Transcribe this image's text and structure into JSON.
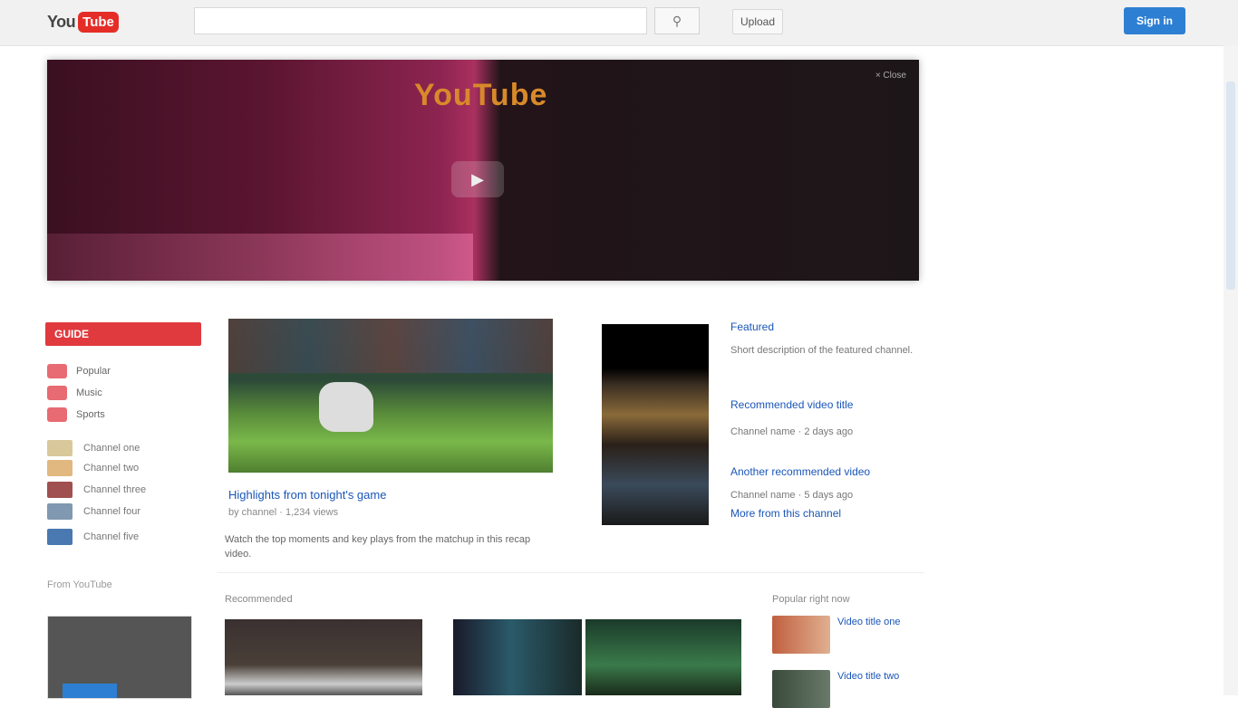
{
  "header": {
    "logo_you": "You",
    "logo_tube": "Tube",
    "search_placeholder": "",
    "upload_label": "Upload",
    "signin_label": "Sign in"
  },
  "banner": {
    "title": "YouTube",
    "close_label": "× Close"
  },
  "sidebar": {
    "guide_label": "GUIDE",
    "nav": [
      "Popular",
      "Music",
      "Sports"
    ],
    "subs": [
      "Channel one",
      "Channel two",
      "Channel three",
      "Channel four",
      "Channel five"
    ],
    "section_label": "From YouTube"
  },
  "feature": {
    "title": "Highlights from tonight's game",
    "meta": "by channel · 1,234 views",
    "description": "Watch the top moments and key plays from the matchup in this recap video."
  },
  "promo": {
    "kicker": "Featured",
    "links": [
      "Recommended video title",
      "Another recommended video",
      "More from this channel"
    ],
    "texts": [
      "Short description of the featured channel.",
      "Channel name · 2 days ago",
      "Channel name · 5 days ago"
    ]
  },
  "bottom": {
    "section_label": "Recommended",
    "side_title": "Popular right now",
    "side_items": [
      "Video title one",
      "Video title two"
    ]
  },
  "colors": {
    "brand_red": "#e52d27",
    "signin_blue": "#2d7fd3",
    "link_blue": "#1a56b8"
  }
}
